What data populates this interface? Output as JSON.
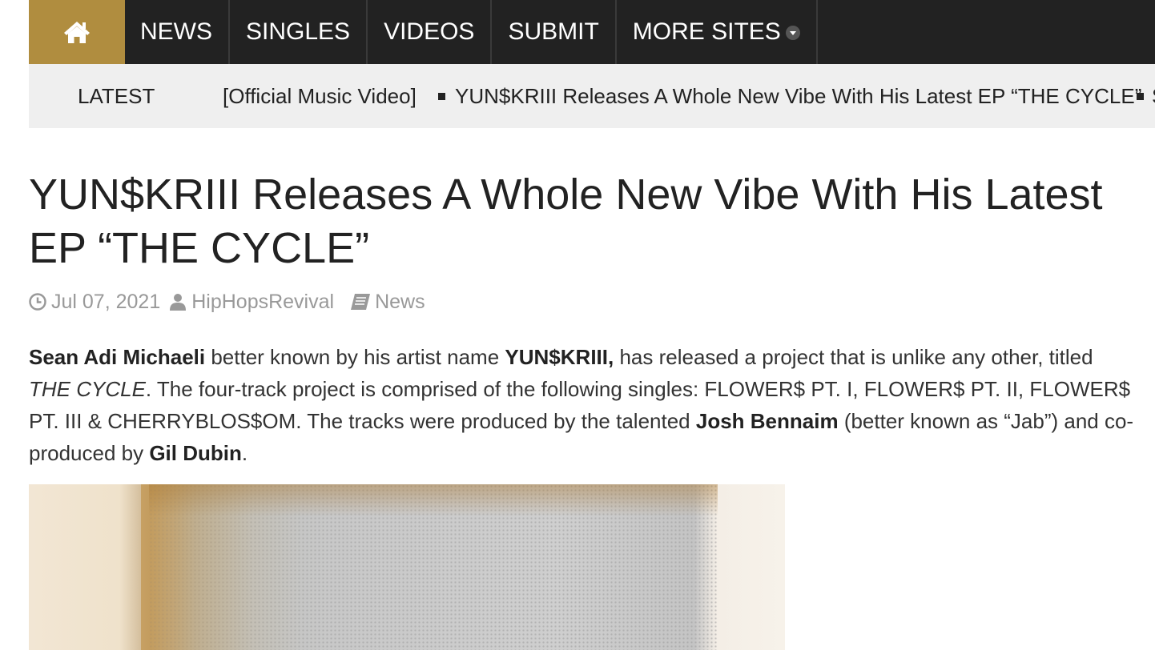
{
  "nav": {
    "home_icon": "home-icon",
    "items": [
      "NEWS",
      "SINGLES",
      "VIDEOS",
      "SUBMIT",
      "MORE SITES"
    ]
  },
  "ticker": {
    "label": "LATEST",
    "items": [
      "[Official Music Video]",
      "YUN$KRIII Releases A Whole New Vibe With His Latest EP “THE CYCLE”"
    ]
  },
  "article": {
    "title_line1": "YUN$KRIII Releases A Whole New Vibe With His Latest",
    "title_line2": "EP “THE CYCLE”",
    "date": "Jul 07, 2021",
    "author": "HipHopsRevival",
    "category": "News",
    "p": {
      "b1": "Sean Adi Michaeli",
      "t1": " better known by his artist name ",
      "b2": "YUN$KRIII,",
      "t2": " has released a project that is unlike any other, titled",
      "i1": "THE CYCLE",
      "t3": ". The four-track project is comprised of the following singles: FLOWER$ PT. I, FLOWER$ PT. II, FLOWER$",
      "t4": "PT. III & CHERRYBLOS$OM. The tracks were produced by the talented ",
      "b3": "Josh Bennaim",
      "t5": " (better known as “Jab”) and co-",
      "t6": "produced by ",
      "b4": "Gil Dubin",
      "t7": "."
    }
  },
  "colors": {
    "nav_bg": "#222222",
    "home_bg": "#b08d3f",
    "ticker_bg": "#efefef",
    "meta": "#999999"
  }
}
